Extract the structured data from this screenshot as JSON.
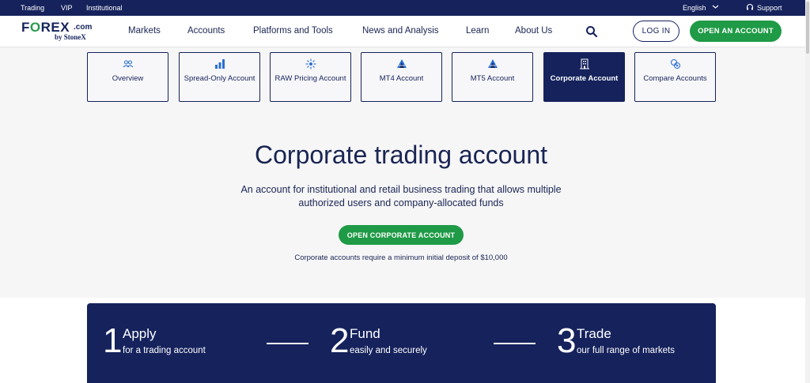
{
  "topbar": {
    "links": [
      "Trading",
      "VIP",
      "Institutional"
    ],
    "language": "English",
    "support": "Support"
  },
  "nav": {
    "logo": {
      "brand_prefix": "F",
      "brand_o": "O",
      "brand_suffix": "REX",
      "dotcom": ".com",
      "by": "by StoneX"
    },
    "menu": [
      "Markets",
      "Accounts",
      "Platforms and Tools",
      "News and Analysis",
      "Learn",
      "About Us"
    ],
    "login": "LOG IN",
    "open_account": "OPEN AN ACCOUNT"
  },
  "tabs": [
    {
      "label": "Overview",
      "icon": "users-icon",
      "active": false
    },
    {
      "label": "Spread-Only Account",
      "icon": "bar-chart-icon",
      "active": false
    },
    {
      "label": "RAW Pricing Account",
      "icon": "spark-icon",
      "active": false
    },
    {
      "label": "MT4 Account",
      "icon": "mt4-icon",
      "active": false
    },
    {
      "label": "MT5 Account",
      "icon": "mt5-icon",
      "active": false
    },
    {
      "label": "Corporate Account",
      "icon": "building-icon",
      "active": true
    },
    {
      "label": "Compare Accounts",
      "icon": "compare-icon",
      "active": false
    }
  ],
  "hero": {
    "title": "Corporate trading account",
    "subtitle": "An account for institutional and retail business trading that allows multiple authorized users and company-allocated funds",
    "cta": "OPEN CORPORATE ACCOUNT",
    "note": "Corporate accounts require a minimum initial deposit of $10,000"
  },
  "steps": [
    {
      "number": "1",
      "title": "Apply",
      "text": "for a trading account"
    },
    {
      "number": "2",
      "title": "Fund",
      "text": "easily and securely"
    },
    {
      "number": "3",
      "title": "Trade",
      "text": "our full range of markets"
    }
  ],
  "colors": {
    "navy": "#15225c",
    "green": "#1f9a46",
    "accent_blue": "#2a6fd6"
  }
}
